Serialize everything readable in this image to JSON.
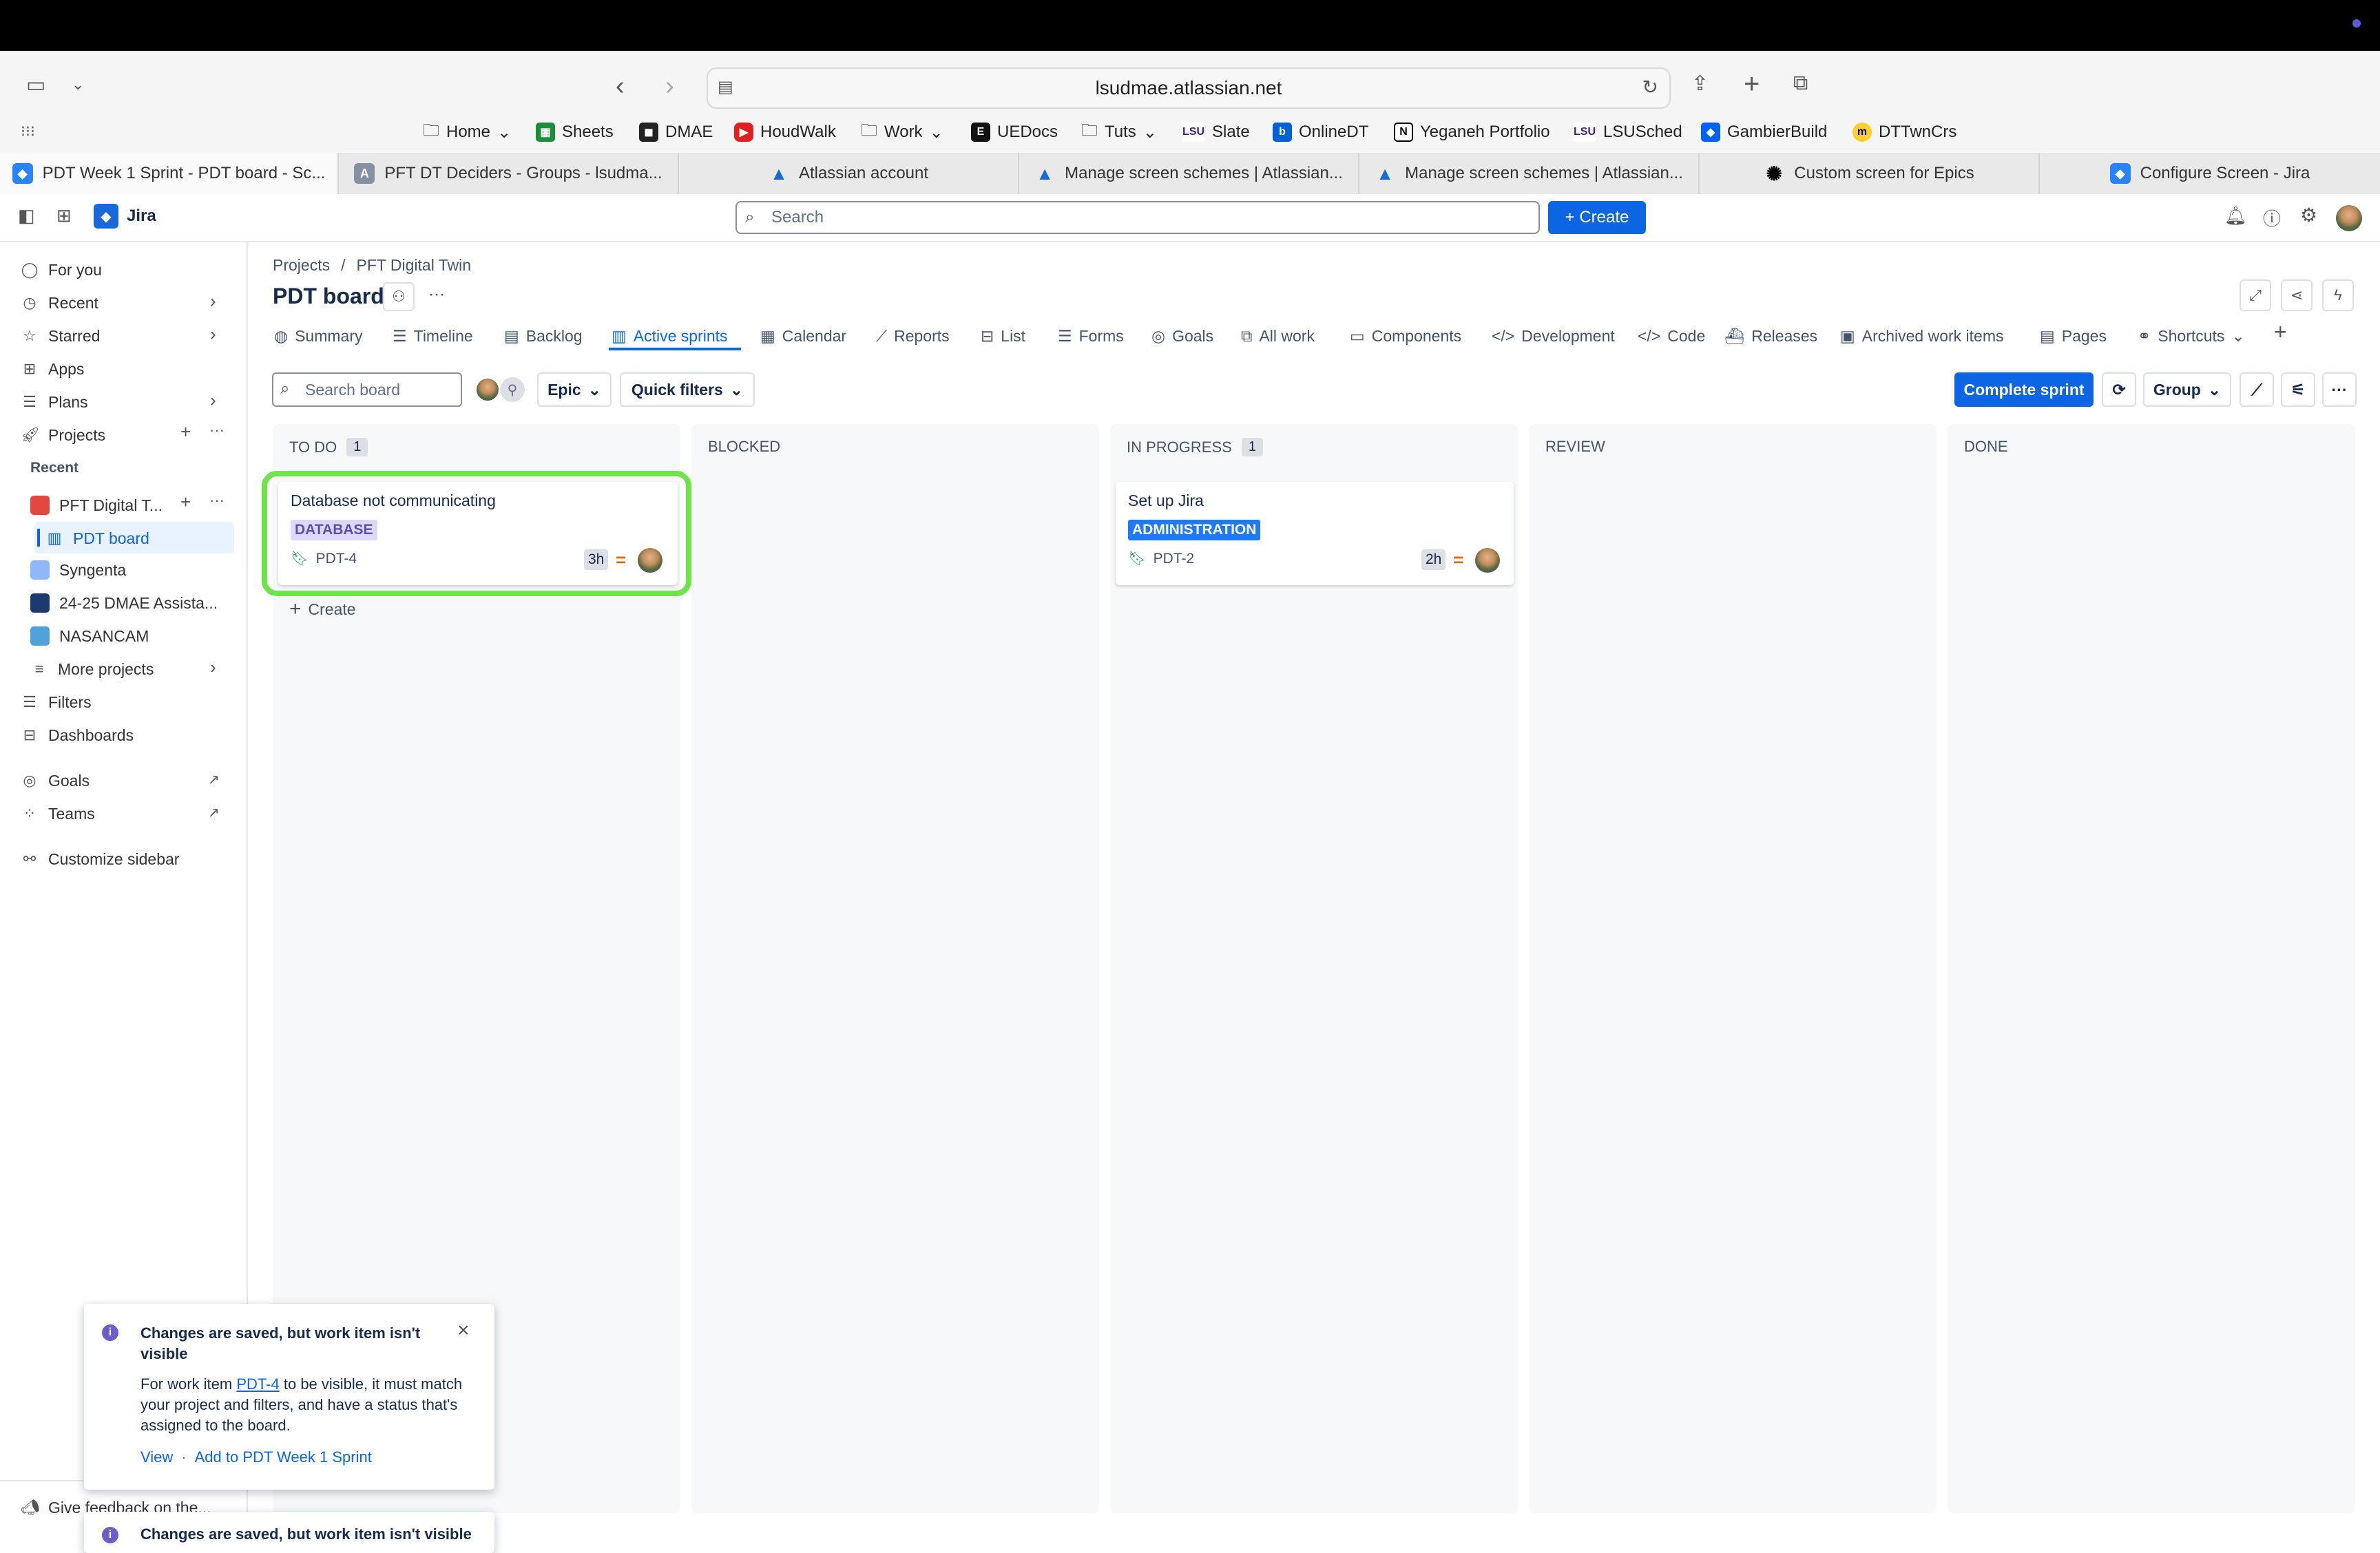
{
  "browser": {
    "url": "lsudmae.atlassian.net",
    "bookmarks": [
      {
        "label": "Home",
        "icon": "folder-icon"
      },
      {
        "label": "Sheets",
        "icon": "sheets-icon"
      },
      {
        "label": "DMAE",
        "icon": "dmae-icon"
      },
      {
        "label": "HoudWalk",
        "icon": "youtube-icon"
      },
      {
        "label": "Work",
        "icon": "folder-icon"
      },
      {
        "label": "UEDocs",
        "icon": "epic-icon"
      },
      {
        "label": "Tuts",
        "icon": "folder-icon"
      },
      {
        "label": "Slate",
        "icon": "lsu-icon"
      },
      {
        "label": "OnlineDT",
        "icon": "box-icon"
      },
      {
        "label": "Yeganeh Portfolio",
        "icon": "notion-icon"
      },
      {
        "label": "LSUSched",
        "icon": "lsu-icon"
      },
      {
        "label": "GambierBuild",
        "icon": "dropbox-icon"
      },
      {
        "label": "DTTwnCrs",
        "icon": "miro-icon"
      }
    ],
    "tabs": [
      {
        "label": "PDT Week 1 Sprint - PDT board - Sc..."
      },
      {
        "label": "PFT DT Deciders - Groups - lsudma..."
      },
      {
        "label": "Atlassian account"
      },
      {
        "label": "Manage screen schemes | Atlassian..."
      },
      {
        "label": "Manage screen schemes | Atlassian..."
      },
      {
        "label": "Custom screen for Epics"
      },
      {
        "label": "Configure Screen - Jira"
      }
    ]
  },
  "topnav": {
    "app_name": "Jira",
    "search_placeholder": "Search",
    "create_label": "+ Create"
  },
  "sidebar": {
    "items": [
      {
        "label": "For you"
      },
      {
        "label": "Recent"
      },
      {
        "label": "Starred"
      },
      {
        "label": "Apps"
      },
      {
        "label": "Plans"
      },
      {
        "label": "Projects"
      }
    ],
    "recent_heading": "Recent",
    "projects": [
      {
        "label": "PFT Digital T..."
      },
      {
        "label": "PDT board"
      },
      {
        "label": "Syngenta"
      },
      {
        "label": "24-25 DMAE Assista..."
      },
      {
        "label": "NASANCAM"
      },
      {
        "label": "More projects"
      }
    ],
    "bottom_items": [
      {
        "label": "Filters"
      },
      {
        "label": "Dashboards"
      },
      {
        "label": "Goals"
      },
      {
        "label": "Teams"
      },
      {
        "label": "Customize sidebar"
      }
    ],
    "feedback_label": "Give feedback on the..."
  },
  "breadcrumb": {
    "projects": "Projects",
    "sep": "/",
    "project": "PFT Digital Twin"
  },
  "page_title": "PDT board",
  "nav_tabs": [
    {
      "label": "Summary"
    },
    {
      "label": "Timeline"
    },
    {
      "label": "Backlog"
    },
    {
      "label": "Active sprints"
    },
    {
      "label": "Calendar"
    },
    {
      "label": "Reports"
    },
    {
      "label": "List"
    },
    {
      "label": "Forms"
    },
    {
      "label": "Goals"
    },
    {
      "label": "All work"
    },
    {
      "label": "Components"
    },
    {
      "label": "Development"
    },
    {
      "label": "Code"
    },
    {
      "label": "Releases"
    },
    {
      "label": "Archived work items"
    },
    {
      "label": "Pages"
    },
    {
      "label": "Shortcuts"
    }
  ],
  "toolbar": {
    "search_placeholder": "Search board",
    "epic_label": "Epic",
    "quick_filters_label": "Quick filters",
    "complete_sprint_label": "Complete sprint",
    "group_label": "Group"
  },
  "columns": [
    {
      "name": "TO DO",
      "count": "1"
    },
    {
      "name": "BLOCKED",
      "count": ""
    },
    {
      "name": "IN PROGRESS",
      "count": "1"
    },
    {
      "name": "REVIEW",
      "count": ""
    },
    {
      "name": "DONE",
      "count": ""
    }
  ],
  "cards": [
    {
      "title": "Database not communicating",
      "epic": "DATABASE",
      "key": "PDT-4",
      "estimate": "3h",
      "epic_color": "#dfd8fd",
      "epic_text_color": "#5e4db2"
    },
    {
      "title": "Set up Jira",
      "epic": "ADMINISTRATION",
      "key": "PDT-2",
      "estimate": "2h",
      "epic_color": "#1d7afc",
      "epic_text_color": "#ffffff"
    }
  ],
  "create_label": "Create",
  "highlight_color": "#6fe34a",
  "toast": {
    "title": "Changes are saved, but work item isn't visible",
    "body_prefix": "For work item",
    "body_link": "PDT-4",
    "body_suffix": "to be visible, it must match your project and filters, and have a status that's assigned to the board.",
    "view_label": "View",
    "dot": "·",
    "add_label": "Add to PDT Week 1 Sprint"
  },
  "toast2": {
    "title": "Changes are saved, but work item isn't visible"
  }
}
